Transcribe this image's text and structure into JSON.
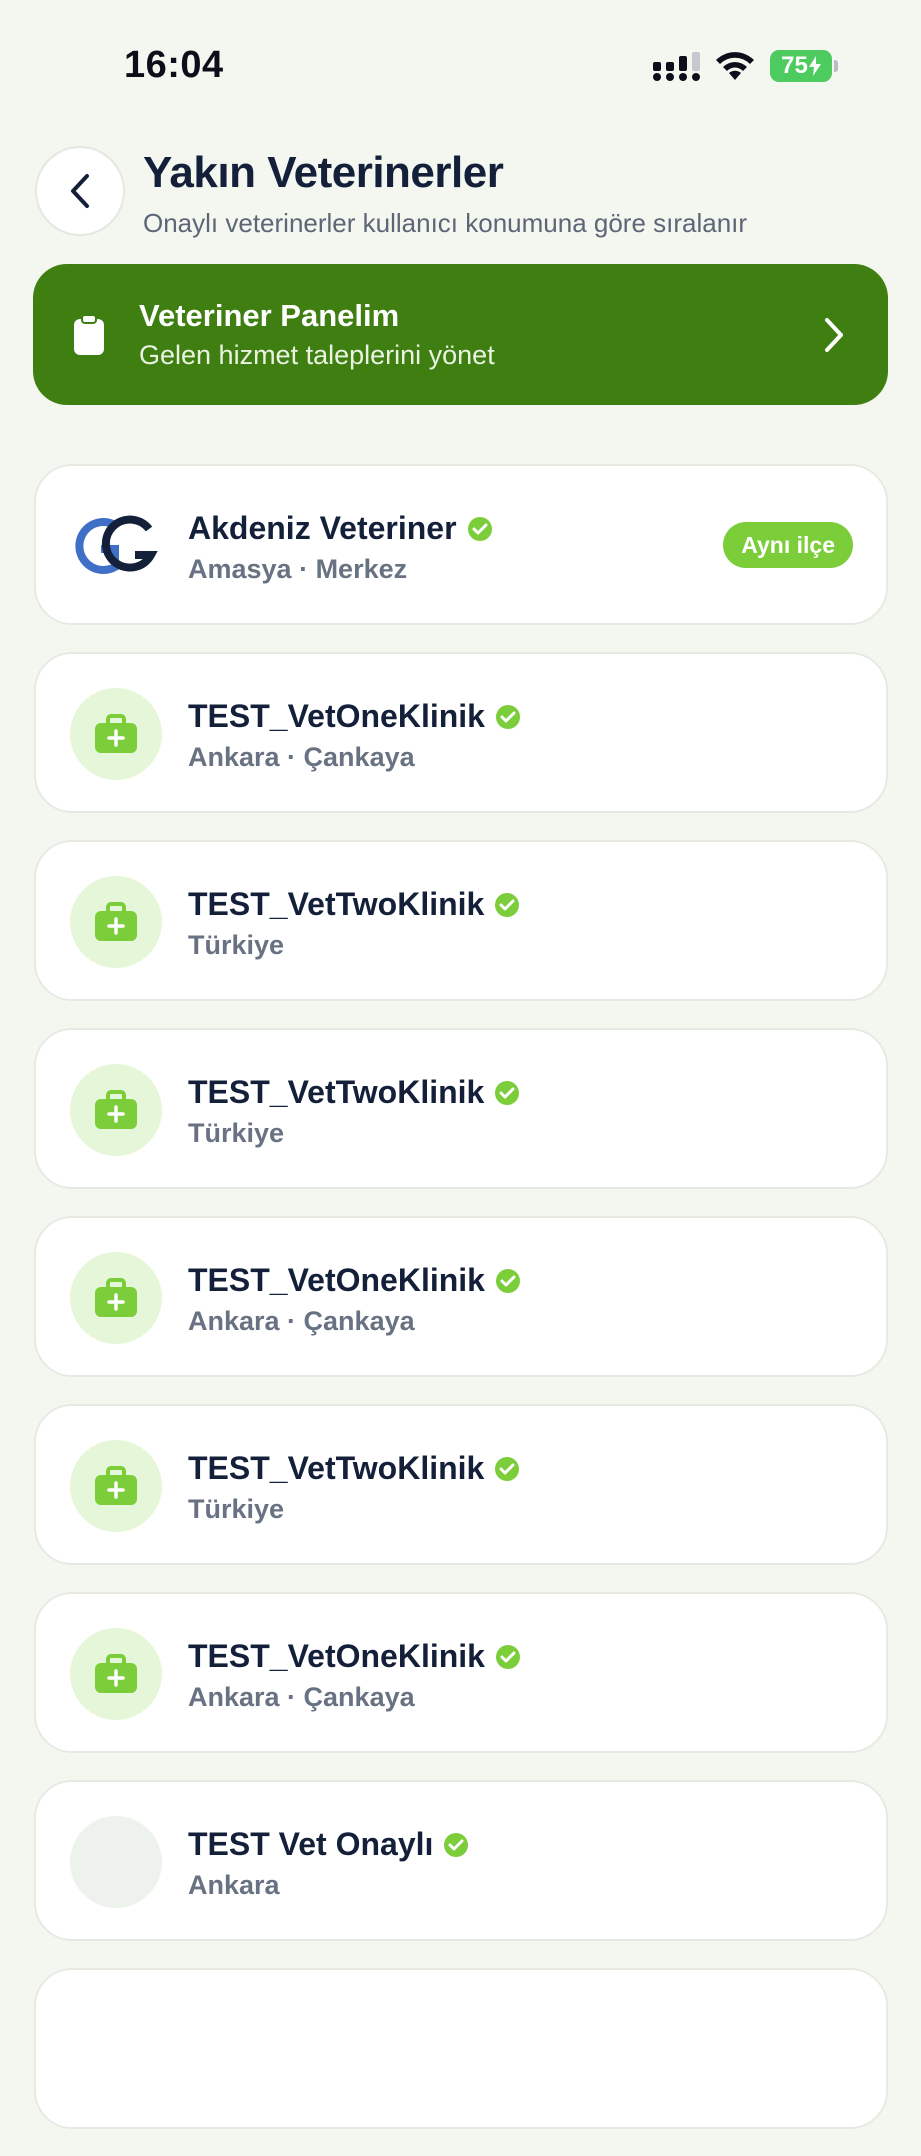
{
  "status_bar": {
    "time": "16:04",
    "battery": "75"
  },
  "header": {
    "title": "Yakın Veterinerler",
    "subtitle": "Onaylı veterinerler kullanıcı konumuna göre sıralanır"
  },
  "panel": {
    "title": "Veteriner Panelim",
    "subtitle": "Gelen hizmet taleplerini yönet"
  },
  "colors": {
    "accent": "#3f7f12",
    "verified": "#7ccd3a",
    "background": "#f3f7f0"
  },
  "vets": [
    {
      "name": "Akdeniz Veteriner",
      "location": "Amasya · Merkez",
      "badge": "Aynı ilçe",
      "avatar": "logo"
    },
    {
      "name": "TEST_VetOneKlinik",
      "location": "Ankara · Çankaya",
      "avatar": "medical-kit-icon"
    },
    {
      "name": "TEST_VetTwoKlinik",
      "location": "Türkiye",
      "avatar": "medical-kit-icon"
    },
    {
      "name": "TEST_VetTwoKlinik",
      "location": "Türkiye",
      "avatar": "medical-kit-icon"
    },
    {
      "name": "TEST_VetOneKlinik",
      "location": "Ankara · Çankaya",
      "avatar": "medical-kit-icon"
    },
    {
      "name": "TEST_VetTwoKlinik",
      "location": "Türkiye",
      "avatar": "medical-kit-icon"
    },
    {
      "name": "TEST_VetOneKlinik",
      "location": "Ankara · Çankaya",
      "avatar": "medical-kit-icon"
    },
    {
      "name": "TEST Vet Onaylı",
      "location": "Ankara",
      "avatar": "empty"
    }
  ]
}
